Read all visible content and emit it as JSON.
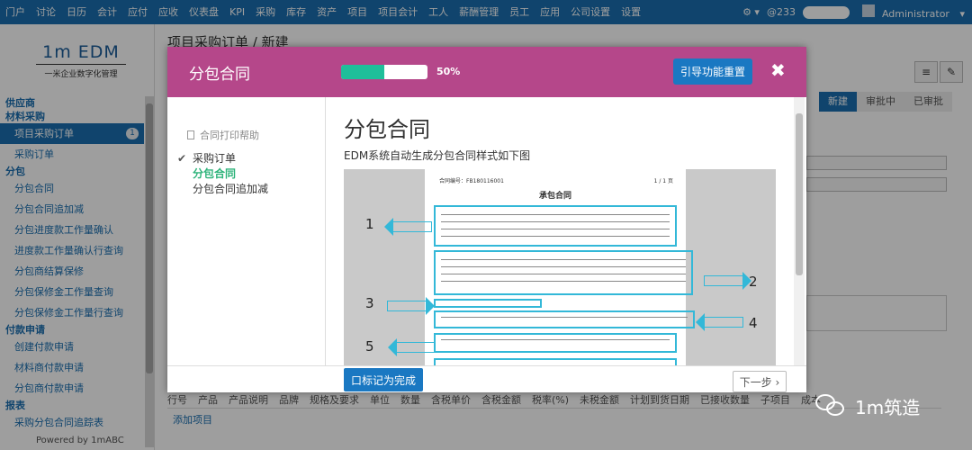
{
  "topnav": {
    "items": [
      "门户",
      "讨论",
      "日历",
      "会计",
      "应付",
      "应收",
      "仪表盘",
      "KPI",
      "采购",
      "库存",
      "资产",
      "项目",
      "项目会计",
      "工人",
      "薪酬管理",
      "员工",
      "应用",
      "公司设置",
      "设置"
    ],
    "count": "@233",
    "user": "Administrator"
  },
  "sidebar": {
    "logo": "1m EDM",
    "tagline": "一米企业数字化管理",
    "sections": [
      {
        "kind": "h",
        "label": "供应商"
      },
      {
        "kind": "h",
        "label": "材料采购"
      },
      {
        "kind": "i",
        "label": "项目采购订单",
        "active": true,
        "badge": "1"
      },
      {
        "kind": "i",
        "label": "采购订单"
      },
      {
        "kind": "h",
        "label": "分包"
      },
      {
        "kind": "i",
        "label": "分包合同"
      },
      {
        "kind": "i",
        "label": "分包合同追加减"
      },
      {
        "kind": "i",
        "label": "分包进度款工作量确认"
      },
      {
        "kind": "i",
        "label": "进度款工作量确认行查询"
      },
      {
        "kind": "i",
        "label": "分包商结算保修"
      },
      {
        "kind": "i",
        "label": "分包保修金工作量查询"
      },
      {
        "kind": "i",
        "label": "分包保修金工作量行查询"
      },
      {
        "kind": "h",
        "label": "付款申请"
      },
      {
        "kind": "i",
        "label": "创建付款申请"
      },
      {
        "kind": "i",
        "label": "材料商付款申请"
      },
      {
        "kind": "i",
        "label": "分包商付款申请"
      },
      {
        "kind": "h",
        "label": "报表"
      },
      {
        "kind": "i",
        "label": "采购分包合同追踪表"
      }
    ],
    "powered": "Powered by 1mABC"
  },
  "page": {
    "title": "项目采购订单 / 新建",
    "steps": [
      "新建",
      "审批中",
      "已审批"
    ],
    "table_headers": [
      "行号",
      "产品",
      "产品说明",
      "品牌",
      "规格及要求",
      "单位",
      "数量",
      "含税单价",
      "含税金额",
      "税率(%)",
      "未税金额",
      "计划到货日期",
      "已接收数量",
      "子项目",
      "成本"
    ],
    "add_row": "添加项目"
  },
  "modal": {
    "title": "分包合同",
    "progress": 0.5,
    "progress_label": "50%",
    "reset_label": "引导功能重置",
    "close_glyph": "✖",
    "help_label": "合同打印帮助",
    "nav": [
      {
        "label": "采购订单",
        "checked": true
      },
      {
        "label": "分包合同",
        "active": true
      },
      {
        "label": "分包合同追加减"
      }
    ],
    "content_title": "分包合同",
    "content_desc": "EDM系统自动生成分包合同样式如下图",
    "preview": {
      "contract_no": "合同编号：FB180116001",
      "page": "1 / 1 页",
      "doc_title": "承包合同",
      "callouts": [
        "1",
        "2",
        "3",
        "4",
        "5"
      ]
    },
    "done_label": "口标记为完成",
    "next_label": "下一步 ›"
  },
  "watermark": "1m筑造",
  "colors": {
    "nav": "#1a6fb0",
    "modal_header": "#b5478a",
    "progress": "#1fbf9a",
    "button": "#1a78c2",
    "highlight": "#33b8d8"
  }
}
